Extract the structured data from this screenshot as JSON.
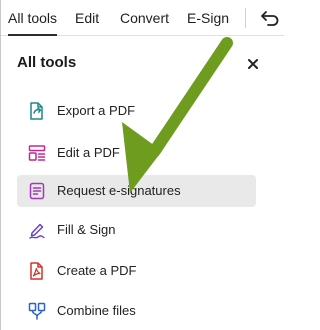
{
  "tabs": [
    {
      "label": "All tools",
      "active": true
    },
    {
      "label": "Edit",
      "active": false
    },
    {
      "label": "Convert",
      "active": false
    },
    {
      "label": "E-Sign",
      "active": false
    }
  ],
  "back_icon": "undo-icon",
  "panel": {
    "title": "All tools",
    "close_icon": "close-icon"
  },
  "tools": [
    {
      "label": "Export a PDF",
      "icon": "export-pdf-icon",
      "color": "#1a8a86"
    },
    {
      "label": "Edit a PDF",
      "icon": "edit-pdf-icon",
      "color": "#c2288f"
    },
    {
      "label": "Request e-signatures",
      "icon": "request-signature-icon",
      "color": "#a03ab8",
      "highlighted": true
    },
    {
      "label": "Fill & Sign",
      "icon": "fill-sign-icon",
      "color": "#6b42c8"
    },
    {
      "label": "Create a PDF",
      "icon": "create-pdf-icon",
      "color": "#d6322c"
    },
    {
      "label": "Combine files",
      "icon": "combine-files-icon",
      "color": "#2f62c8"
    }
  ],
  "annotation": {
    "arrow_color": "#6e9c1e",
    "arrow_icon": "green-arrow"
  }
}
